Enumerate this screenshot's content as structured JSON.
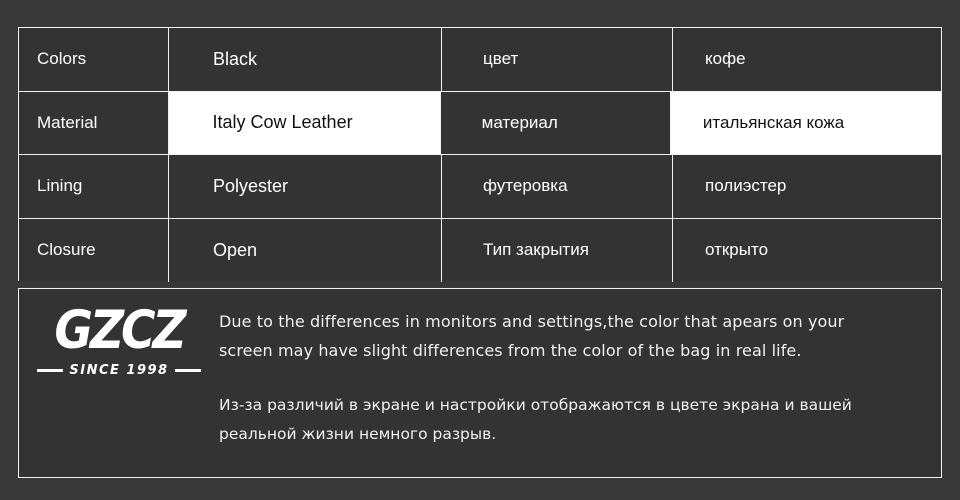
{
  "table": {
    "columns": [
      "label_en",
      "value_en",
      "label_ru",
      "value_ru"
    ],
    "rows": [
      {
        "label_en": "Colors",
        "value_en": "Black",
        "label_ru": "цвет",
        "value_ru": "кофе",
        "highlighted": false
      },
      {
        "label_en": "Material",
        "value_en": "Italy Cow Leather",
        "label_ru": "материал",
        "value_ru": "итальянская кожа",
        "highlighted": true
      },
      {
        "label_en": "Lining",
        "value_en": "Polyester",
        "label_ru": "футеровка",
        "value_ru": "полиэстер",
        "highlighted": false
      },
      {
        "label_en": "Closure",
        "value_en": "Open",
        "label_ru": "Тип закрытия",
        "value_ru": "открыто",
        "highlighted": false
      }
    ]
  },
  "notice": {
    "logo": {
      "wordmark": "GZCZ",
      "tagline": "SINCE 1998"
    },
    "paragraph_en": "Due to the differences in monitors and settings,the color that apears on your screen may have slight differences from the color of the bag in real life.",
    "paragraph_ru": "Из-за различий в экране и настройки отображаются в цвете экрана и вашей реальной жизни немного разрыв."
  },
  "colors": {
    "page_background": "#383838",
    "cell_background": "#333333",
    "border": "#f2f2f2",
    "text": "#ffffff",
    "highlight_background": "#ffffff",
    "highlight_text": "#111111"
  }
}
